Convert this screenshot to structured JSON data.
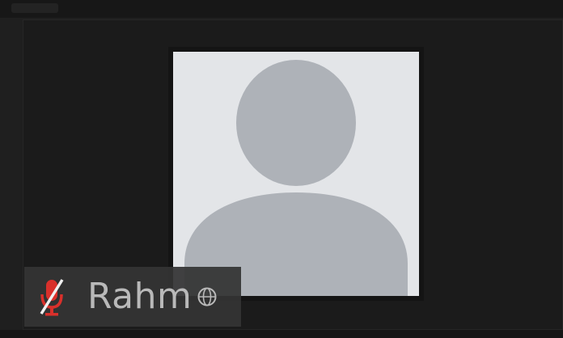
{
  "participant": {
    "name": "Rahm",
    "mic_state": "muted",
    "status_icon": "globe-badge-icon"
  },
  "avatar": {
    "type": "default-silhouette",
    "background_color": "#e3e5e8",
    "silhouette_color": "#aeb2b8"
  },
  "colors": {
    "muted_indicator": "#d9302b",
    "tile_background": "#1b1b1b",
    "name_tag_background": "#343434",
    "name_text": "#b9b9b9"
  }
}
